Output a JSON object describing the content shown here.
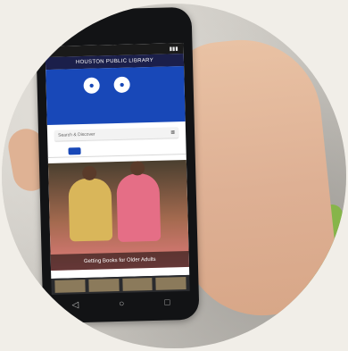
{
  "app": {
    "header_title": "HOUSTON PUBLIC LIBRARY"
  },
  "search": {
    "placeholder": "Search & Discover"
  },
  "feature": {
    "caption": "Getting Books for Older Adults"
  }
}
